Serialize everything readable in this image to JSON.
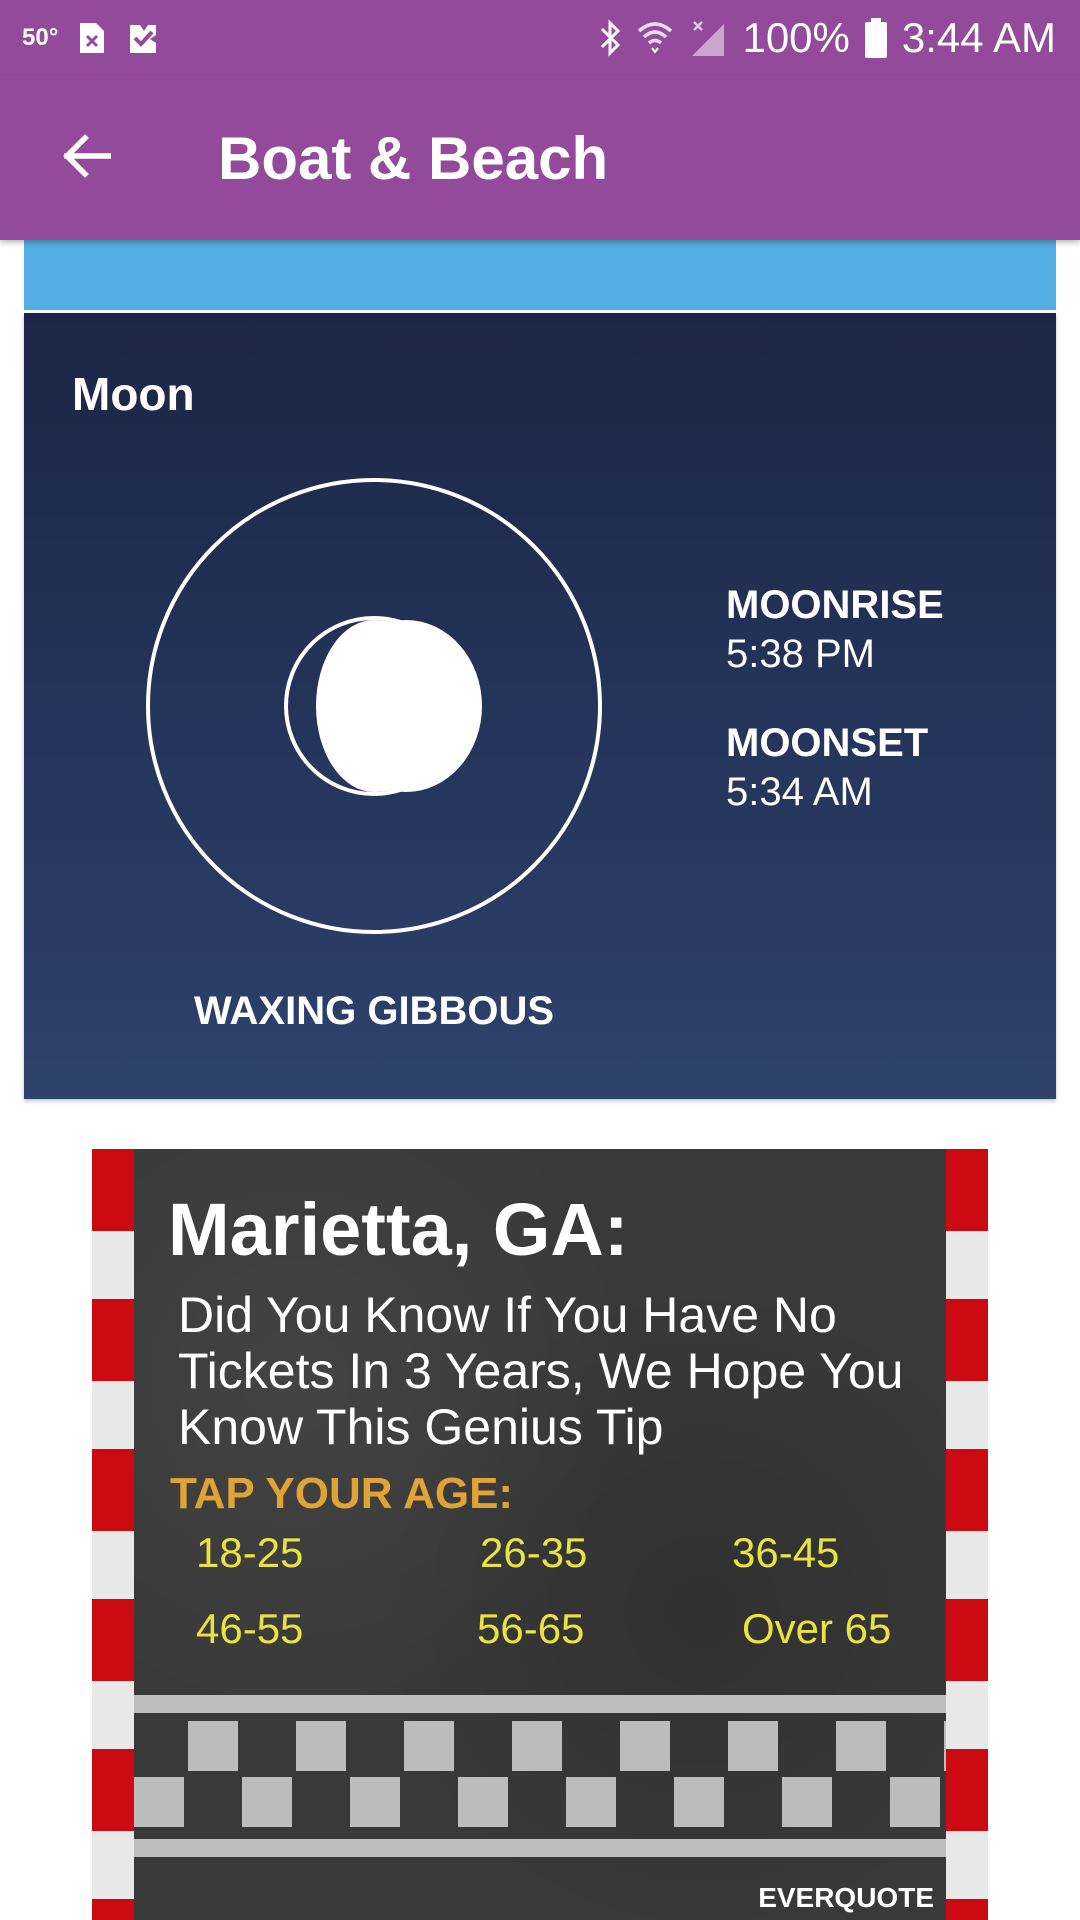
{
  "status_bar": {
    "temperature": "50°",
    "battery": "100%",
    "time": "3:44 AM"
  },
  "app_bar": {
    "title": "Boat & Beach"
  },
  "moon_card": {
    "title": "Moon",
    "phase": "WAXING GIBBOUS",
    "moonrise_label": "MOONRISE",
    "moonrise_time": "5:38 PM",
    "moonset_label": "MOONSET",
    "moonset_time": "5:34 AM"
  },
  "ad": {
    "headline": "Marietta, GA:",
    "body": "Did You Know If You Have No Tickets In 3 Years, We Hope You Know This Genius Tip",
    "cta": "TAP YOUR AGE:",
    "ages": [
      "18-25",
      "26-35",
      "36-45",
      "46-55",
      "56-65",
      "Over 65"
    ],
    "brand": "EVERQUOTE"
  },
  "colors": {
    "app_bar": "#944a9b",
    "blue_strip": "#55aee3",
    "moon_card_top": "#1c2545",
    "moon_card_bottom": "#2d426d",
    "ad_cta": "#e0a336",
    "ad_age": "#e9e342",
    "ad_rail_red": "#cc0a12"
  },
  "icons": {
    "status_left": [
      "notification-x-icon",
      "check-badge-icon"
    ],
    "status_right": [
      "bluetooth-icon",
      "wifi-icon",
      "signal-icon",
      "battery-icon"
    ],
    "back": "arrow-left-icon",
    "moon": "moon-phase-icon"
  }
}
